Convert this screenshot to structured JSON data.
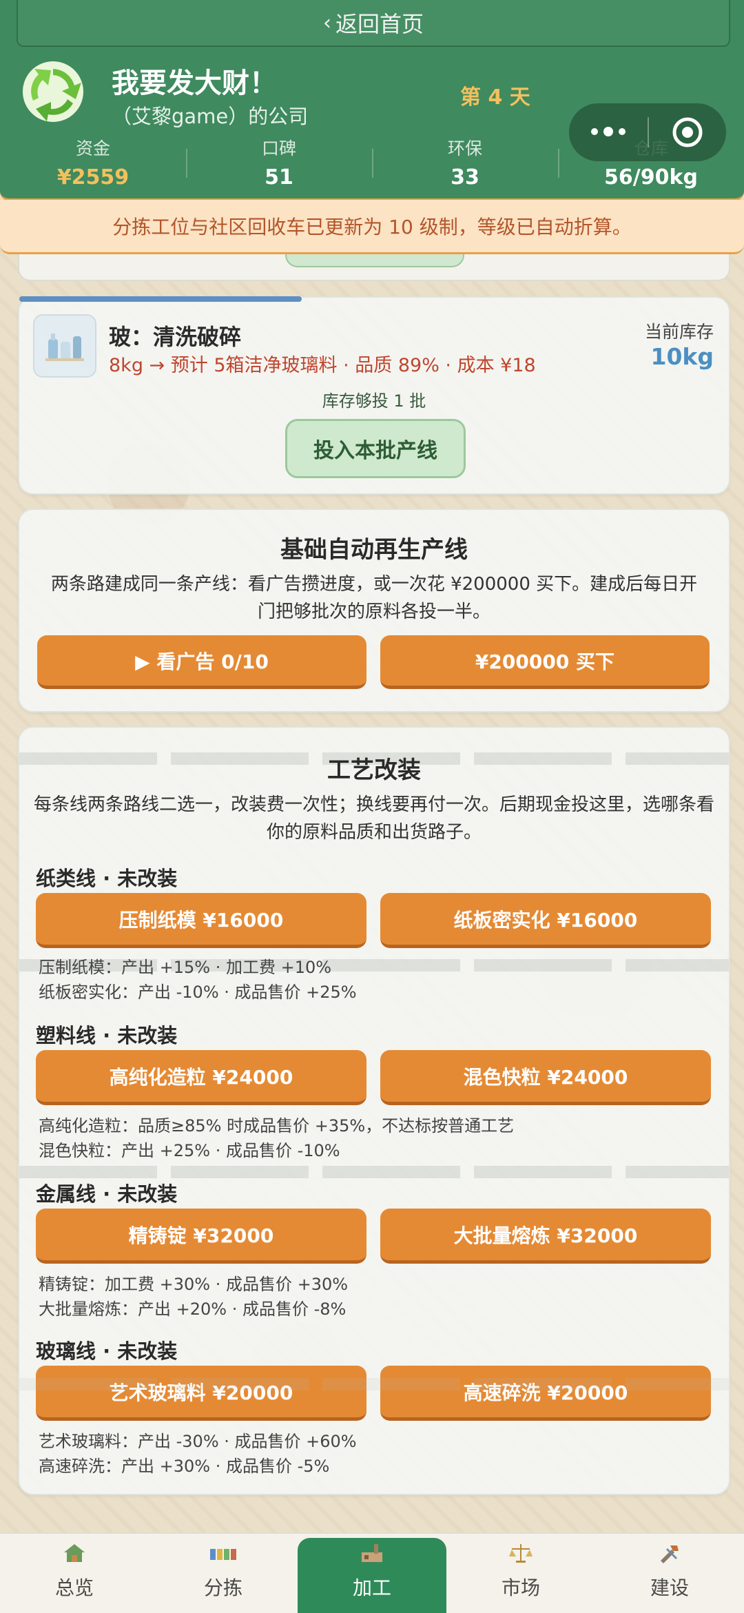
{
  "header": {
    "back_label": "返回首页",
    "company_name": "我要发大财！",
    "owner_line": "（艾黎game）的公司",
    "day_label": "第 4 天",
    "stats": [
      {
        "label": "资金",
        "value": "¥2559"
      },
      {
        "label": "口碑",
        "value": "51"
      },
      {
        "label": "环保",
        "value": "33"
      },
      {
        "label": "仓库",
        "value": "56/90kg"
      }
    ]
  },
  "notice": "分拣工位与社区回收车已更新为 10 级制，等级已自动折算。",
  "glass_line": {
    "title": "玻：清洗破碎",
    "desc": "8kg → 预计 5箱洁净玻璃料 · 品质 89% · 成本 ¥18",
    "stock_label": "当前库存",
    "stock_value": "10kg",
    "batch_note": "库存够投 1 批",
    "put_button": "投入本批产线"
  },
  "auto_line": {
    "title": "基础自动再生产线",
    "desc": "两条路建成同一条产线：看广告攒进度，或一次花 ¥200000 买下。建成后每日开门把够批次的原料各投一半。",
    "ad_button": "▶ 看广告 0/10",
    "buy_button": "¥200000 买下"
  },
  "craft": {
    "title": "工艺改装",
    "desc": "每条线两条路线二选一，改装费一次性；换线要再付一次。后期现金投这里，选哪条看你的原料品质和出货路子。",
    "lines": [
      {
        "head": "纸类线 · 未改装",
        "btn_a": "压制纸模 ¥16000",
        "btn_b": "纸板密实化 ¥16000",
        "note_a": "压制纸模：产出 +15% · 加工费 +10%",
        "note_b": "纸板密实化：产出 -10% · 成品售价 +25%"
      },
      {
        "head": "塑料线 · 未改装",
        "btn_a": "高纯化造粒 ¥24000",
        "btn_b": "混色快粒 ¥24000",
        "note_a": "高纯化造粒：品质≥85% 时成品售价 +35%，不达标按普通工艺",
        "note_b": "混色快粒：产出 +25% · 成品售价 -10%"
      },
      {
        "head": "金属线 · 未改装",
        "btn_a": "精铸锭 ¥32000",
        "btn_b": "大批量熔炼 ¥32000",
        "note_a": "精铸锭：加工费 +30% · 成品售价 +30%",
        "note_b": "大批量熔炼：产出 +20% · 成品售价 -8%"
      },
      {
        "head": "玻璃线 · 未改装",
        "btn_a": "艺术玻璃料 ¥20000",
        "btn_b": "高速碎洗 ¥20000",
        "note_a": "艺术玻璃料：产出 -30% · 成品售价 +60%",
        "note_b": "高速碎洗：产出 +30% · 成品售价 -5%"
      }
    ]
  },
  "nav": [
    {
      "label": "总览",
      "icon": "overview-icon"
    },
    {
      "label": "分拣",
      "icon": "sorting-icon"
    },
    {
      "label": "加工",
      "icon": "processing-icon"
    },
    {
      "label": "市场",
      "icon": "market-icon"
    },
    {
      "label": "建设",
      "icon": "build-icon"
    }
  ],
  "colors": {
    "header_green": "#3f8a5f",
    "accent_orange": "#e58a34",
    "money_gold": "#f3c05e",
    "warning_red": "#c0452f",
    "stock_blue": "#4c8fc2"
  }
}
